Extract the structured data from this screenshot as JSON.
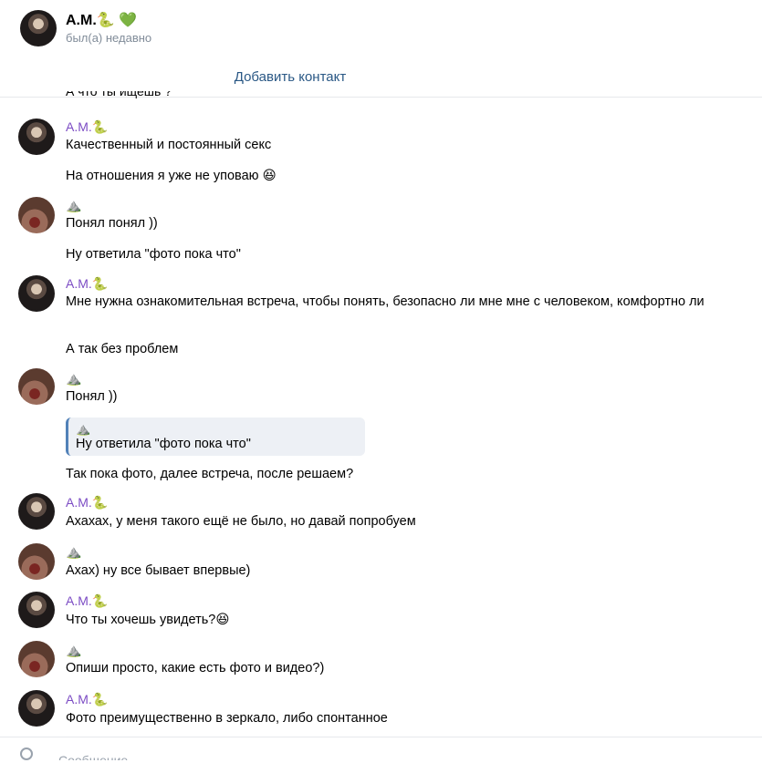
{
  "header": {
    "name": "А.М.🐍 💚",
    "status": "был(а) недавно"
  },
  "add_contact": {
    "label": "Добавить контакт"
  },
  "clipped_top_text": "А что ты ищешь ?",
  "messages": [
    {
      "author": "А.М.🐍",
      "lines": [
        "Качественный и постоянный секс",
        "На отношения я уже не уповаю 😆"
      ]
    },
    {
      "author": "⛰️",
      "lines": [
        "Понял понял ))",
        "Ну ответила \"фото пока что\""
      ]
    },
    {
      "author": "А.М.🐍",
      "lines": [
        "Мне нужна ознакомительная встреча, чтобы понять, безопасно ли мне мне с человеком, комфортно ли",
        "А так без проблем"
      ]
    },
    {
      "author": "⛰️",
      "lines": [
        "Понял ))",
        "Так пока фото, далее встреча, после решаем?"
      ],
      "quote": {
        "author": "⛰️",
        "text": "Ну ответила \"фото пока что\""
      }
    },
    {
      "author": "А.М.🐍",
      "lines": [
        "Ахахах, у меня такого ещё не было, но давай попробуем"
      ]
    },
    {
      "author": "⛰️",
      "lines": [
        "Ахах) ну все бывает впервые)"
      ]
    },
    {
      "author": "А.М.🐍",
      "lines": [
        "Что ты хочешь увидеть?😆"
      ]
    },
    {
      "author": "⛰️",
      "lines": [
        "Опиши просто, какие есть фото и видео?)"
      ]
    },
    {
      "author": "А.М.🐍",
      "lines": [
        "Фото преимущественно в зеркало, либо спонтанное"
      ]
    }
  ],
  "composer": {
    "placeholder": "Сообщение..."
  }
}
